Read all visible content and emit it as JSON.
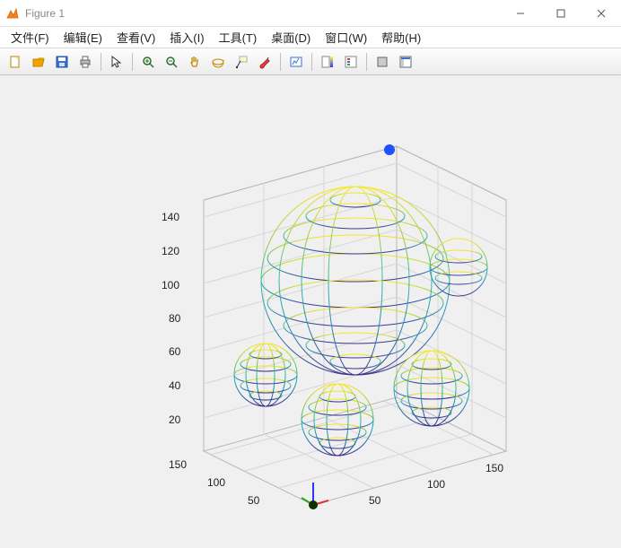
{
  "window": {
    "title": "Figure 1",
    "min_tooltip": "Minimize",
    "max_tooltip": "Maximize",
    "close_tooltip": "Close"
  },
  "menu": {
    "file": "文件(F)",
    "edit": "编辑(E)",
    "view": "查看(V)",
    "insert": "插入(I)",
    "tools": "工具(T)",
    "desktop": "桌面(D)",
    "window_menu": "窗口(W)",
    "help": "帮助(H)"
  },
  "toolbar": {
    "new": "New Figure",
    "open": "Open",
    "save": "Save",
    "print": "Print",
    "pointer": "Edit Plot",
    "zoom_in": "Zoom In",
    "zoom_out": "Zoom Out",
    "pan": "Pan",
    "rotate": "Rotate 3D",
    "data_cursor": "Data Cursor",
    "brush": "Brush",
    "link": "Link Plot",
    "colorbar": "Insert Colorbar",
    "legend": "Insert Legend",
    "hide": "Hide Plot Tools",
    "show": "Show Plot Tools"
  },
  "chart_data": {
    "type": "3d-surface-spheres",
    "xlabel": "",
    "ylabel": "",
    "zlabel": "",
    "x_ticks": [
      50,
      100,
      150
    ],
    "y_ticks": [
      50,
      100,
      150
    ],
    "z_ticks": [
      20,
      40,
      60,
      80,
      100,
      120,
      140
    ],
    "xlim": [
      0,
      160
    ],
    "ylim": [
      0,
      160
    ],
    "zlim": [
      0,
      150
    ],
    "colormap": "parula",
    "spheres": [
      {
        "center": [
          80,
          80,
          80
        ],
        "radius": 55,
        "note": "large center sphere"
      },
      {
        "center": [
          40,
          120,
          40
        ],
        "radius": 22,
        "note": "back-left small"
      },
      {
        "center": [
          150,
          120,
          100
        ],
        "radius": 20,
        "note": "far-right partly occluded"
      },
      {
        "center": [
          65,
          40,
          35
        ],
        "radius": 25,
        "note": "front-center small"
      },
      {
        "center": [
          120,
          50,
          50
        ],
        "radius": 28,
        "note": "front-right small"
      }
    ],
    "markers": [
      {
        "pos": [
          0,
          160,
          150
        ],
        "color": "#1E50FF",
        "label": "blue top marker"
      },
      {
        "pos": [
          0,
          0,
          0
        ],
        "color": "#104000",
        "label": "dark origin marker"
      }
    ],
    "origin_axes_indicator": true
  }
}
